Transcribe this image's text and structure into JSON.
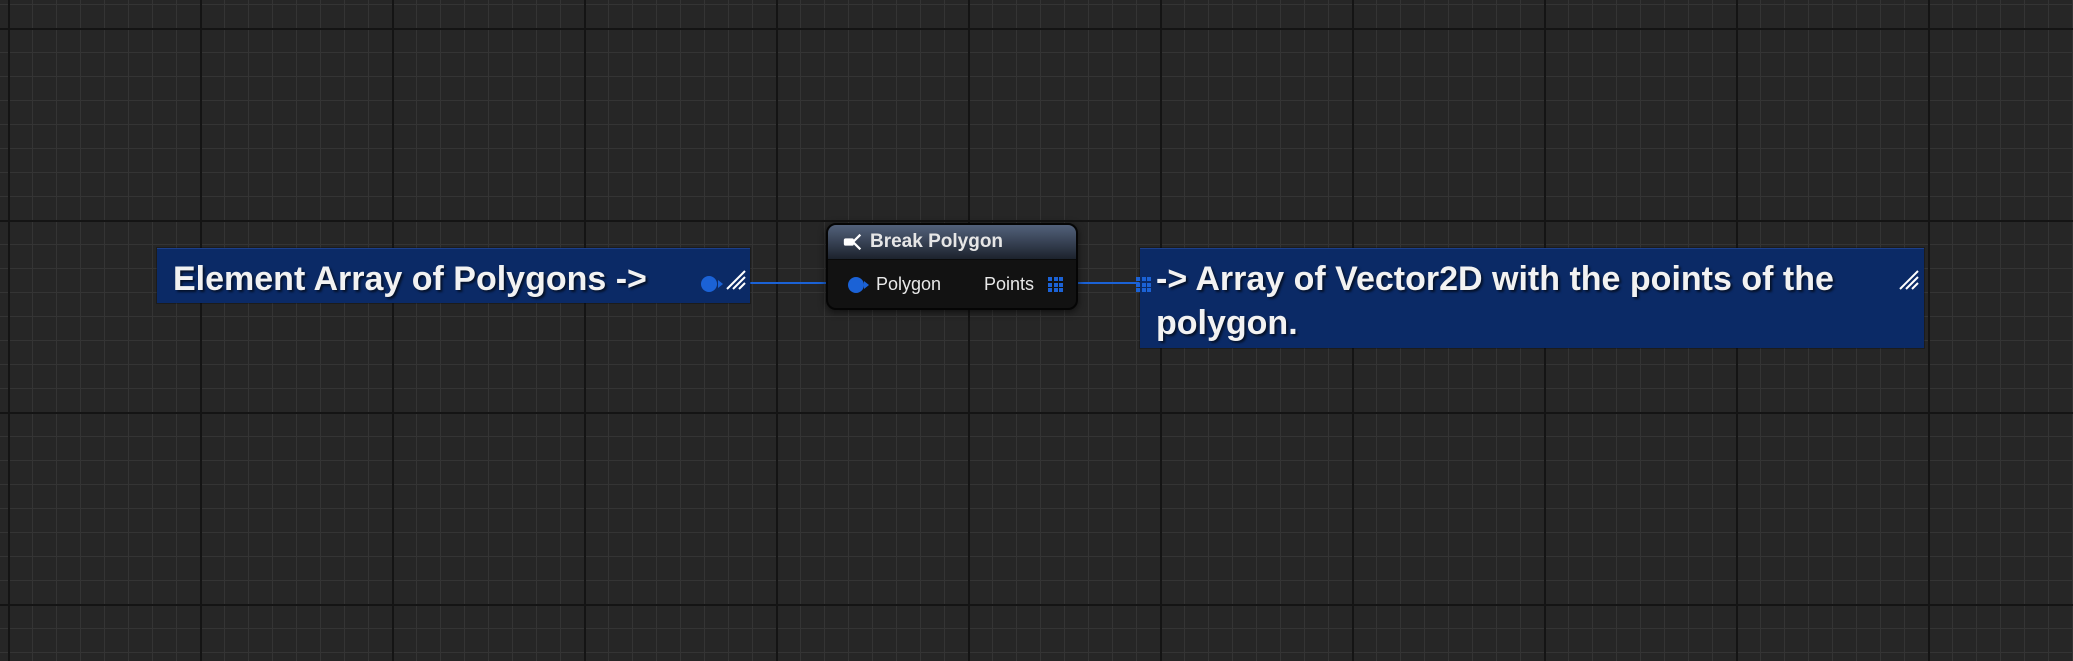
{
  "graph": {
    "background_color": "#262626",
    "wire_color": "#1b62d6"
  },
  "comment_left": {
    "text": "Element Array of Polygons ->",
    "color": "#0b2a66"
  },
  "node": {
    "title": "Break Polygon",
    "icon": "break-struct-icon",
    "input_pin_label": "Polygon",
    "output_pin_label": "Points"
  },
  "comment_right": {
    "text": "-> Array of Vector2D with the points of the polygon.",
    "color": "#0b2a66"
  }
}
